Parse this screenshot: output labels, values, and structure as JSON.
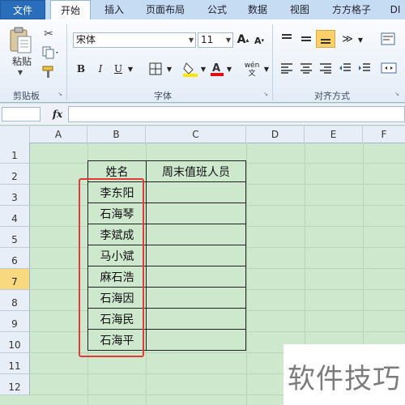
{
  "tabs": [
    "文件",
    "开始",
    "插入",
    "页面布局",
    "公式",
    "数据",
    "视图",
    "方方格子",
    "DI"
  ],
  "ribbon": {
    "clipboard": {
      "paste_label": "粘贴",
      "group_label": "剪贴板"
    },
    "font": {
      "font_name": "宋体",
      "font_size": "11",
      "bold": "B",
      "italic": "I",
      "underline": "U",
      "wen": "wén\n文",
      "group_label": "字体"
    },
    "alignment": {
      "group_label": "对齐方式"
    }
  },
  "formula_bar": {
    "fx": "fx",
    "value": ""
  },
  "columns": [
    "A",
    "B",
    "C",
    "D",
    "E",
    "F"
  ],
  "rows": [
    "1",
    "2",
    "3",
    "4",
    "5",
    "6",
    "7",
    "8",
    "9",
    "10",
    "11",
    "12"
  ],
  "selected_row": "7",
  "table": {
    "headers": [
      "姓名",
      "周末值班人员"
    ],
    "names": [
      "李东阳",
      "石海琴",
      "李斌成",
      "马小斌",
      "麻石浩",
      "石海因",
      "石海民",
      "石海平"
    ]
  },
  "watermark": "软件技巧",
  "colors": {
    "grid_bg": "#cde8cd",
    "highlight": "#e23a36",
    "selected_row": "#f9d97f"
  }
}
